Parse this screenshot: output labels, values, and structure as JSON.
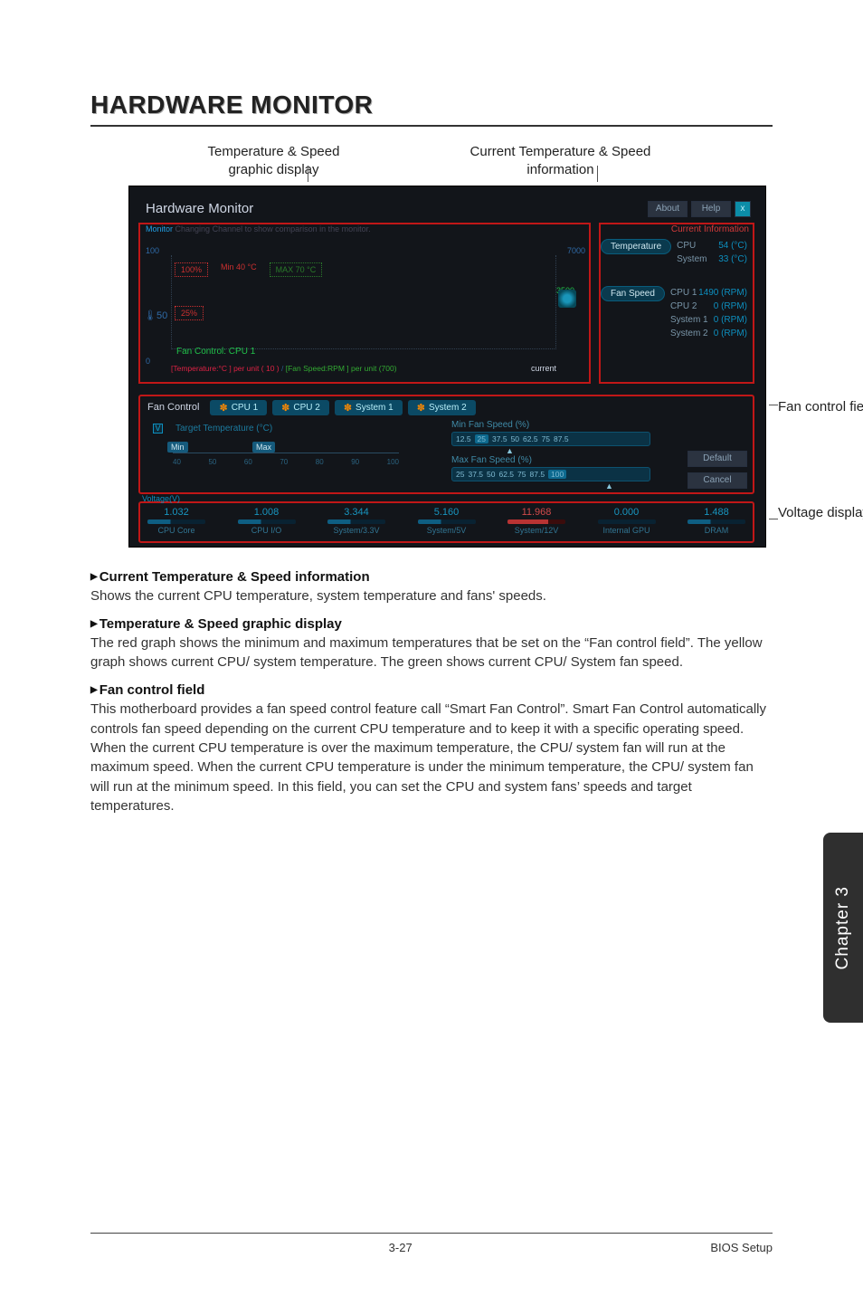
{
  "page": {
    "title": "HARDWARE MONITOR",
    "footer_page": "3-27",
    "footer_section": "BIOS Setup",
    "side_tab": "Chapter 3"
  },
  "diagram_labels": {
    "left": "Temperature & Speed\ngraphic display",
    "right": "Current Temperature & Speed information",
    "fan": "Fan control field",
    "voltage": "Voltage display"
  },
  "hwmon": {
    "title": "Hardware Monitor",
    "about": "About",
    "help": "Help",
    "close": "x",
    "monitor_kw": "Monitor",
    "monitor_text": "Changing Channel to show comparison in the monitor.",
    "info_header": "Current Information",
    "temperature_pill": "Temperature",
    "fanspeed_pill": "Fan Speed",
    "temp": [
      {
        "k": "CPU",
        "v": "54 (°C)"
      },
      {
        "k": "System",
        "v": "33 (°C)"
      }
    ],
    "fan": [
      {
        "k": "CPU 1",
        "v": "1490 (RPM)"
      },
      {
        "k": "CPU 2",
        "v": "0 (RPM)"
      },
      {
        "k": "System 1",
        "v": "0 (RPM)"
      },
      {
        "k": "System 2",
        "v": "0 (RPM)"
      }
    ],
    "graph": {
      "y_left_top": "100",
      "y_right_top": "7000",
      "y_left_mid": "50",
      "box100": "100%",
      "box_min": "Min 40 °C",
      "box_max": "MAX 70 °C",
      "box25": "25%",
      "y_right_mid": "3500",
      "legend": "Fan Control: CPU 1",
      "footer_red": "[Temperature:°C ] per unit ( 10 )",
      "footer_sep": " / ",
      "footer_green": "[Fan Speed:RPM ] per unit (700)",
      "current": "current",
      "zero": "0"
    },
    "fan_control": {
      "label": "Fan Control",
      "tabs": [
        "CPU 1",
        "CPU 2",
        "System 1",
        "System 2"
      ],
      "tt_checkbox": "V",
      "tt_label": "Target Temperature (°C)",
      "tt_min": "Min",
      "tt_max": "Max",
      "tt_ticks": [
        "40",
        "50",
        "60",
        "70",
        "80",
        "90",
        "100"
      ],
      "min_fan_label": "Min Fan Speed (%)",
      "min_fan_opts": [
        "12.5",
        "25",
        "37.5",
        "50",
        "62.5",
        "75",
        "87.5"
      ],
      "min_fan_hl": "25",
      "max_fan_label": "Max Fan Speed (%)",
      "max_fan_opts": [
        "25",
        "37.5",
        "50",
        "62.5",
        "75",
        "87.5",
        "100"
      ],
      "max_fan_hl": "100",
      "default_btn": "Default",
      "cancel_btn": "Cancel"
    },
    "voltage": {
      "header": "Voltage(V)",
      "cols": [
        {
          "num": "1.032",
          "name": "CPU Core"
        },
        {
          "num": "1.008",
          "name": "CPU I/O"
        },
        {
          "num": "3.344",
          "name": "System/3.3V"
        },
        {
          "num": "5.160",
          "name": "System/5V"
        },
        {
          "num": "11.968",
          "name": "System/12V",
          "sp": true
        },
        {
          "num": "0.000",
          "name": "Internal GPU"
        },
        {
          "num": "1.488",
          "name": "DRAM"
        }
      ]
    }
  },
  "sections": {
    "s1_h": "Current Temperature & Speed information",
    "s1_p": "Shows the current CPU temperature, system temperature and fans' speeds.",
    "s2_h": "Temperature & Speed graphic display",
    "s2_p": "The red graph shows the minimum and maximum temperatures that be set on the “Fan control field”.  The yellow graph shows current CPU/ system temperature. The green shows current CPU/ System fan speed.",
    "s3_h": "Fan control field",
    "s3_p": "This motherboard provides a fan speed control feature call “Smart Fan Control”. Smart Fan Control automatically controls fan speed depending on the current CPU temperature and to keep it with a specific operating speed. When the current CPU temperature is over the maximum temperature, the CPU/ system fan will run at the maximum speed. When the current CPU temperature is under the minimum temperature, the CPU/ system fan will run at the minimum speed. In this field, you can set the CPU and system fans’ speeds and target temperatures."
  }
}
